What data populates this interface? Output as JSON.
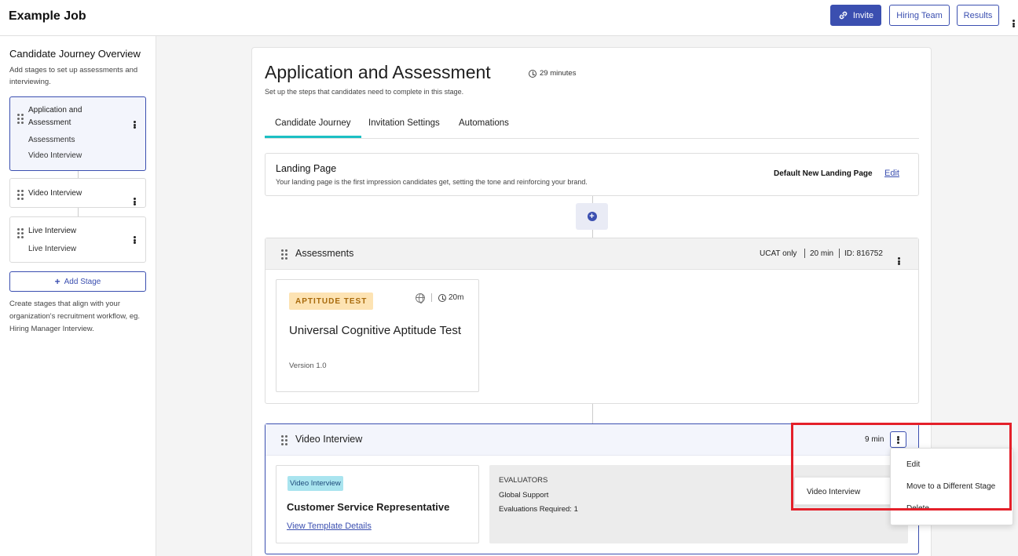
{
  "header": {
    "job_title": "Example Job",
    "invite_label": "Invite",
    "hiring_team_label": "Hiring Team",
    "results_label": "Results"
  },
  "sidebar": {
    "title": "Candidate Journey Overview",
    "description": "Add stages to set up assessments and interviewing.",
    "stages": [
      {
        "name": "Application and Assessment",
        "items": [
          "Assessments",
          "Video Interview"
        ]
      },
      {
        "name": "Video Interview",
        "items": []
      },
      {
        "name": "Live Interview",
        "items": [
          "Live Interview"
        ]
      }
    ],
    "add_stage_label": "Add Stage",
    "footer_text": "Create stages that align with your organization's recruitment workflow, eg. Hiring Manager Interview."
  },
  "main": {
    "title": "Application and Assessment",
    "duration": "29 minutes",
    "subtitle": "Set up the steps that candidates need to complete in this stage.",
    "tabs": [
      {
        "label": "Candidate Journey",
        "active": true
      },
      {
        "label": "Invitation Settings",
        "active": false
      },
      {
        "label": "Automations",
        "active": false
      }
    ],
    "landing_page": {
      "title": "Landing Page",
      "description": "Your landing page is the first impression candidates get, setting the tone and reinforcing your brand.",
      "selected": "Default New Landing Page",
      "edit_label": "Edit"
    },
    "assessments": {
      "title": "Assessments",
      "meta_type": "UCAT only",
      "meta_duration": "20 min",
      "meta_id": "ID: 816752",
      "test": {
        "badge": "APTITUDE TEST",
        "duration": "20m",
        "name": "Universal Cognitive Aptitude Test",
        "version": "Version 1.0"
      }
    },
    "video_interview": {
      "title": "Video Interview",
      "duration": "9 min",
      "badge": "Video Interview",
      "template_name": "Customer Service Representative",
      "template_link": "View Template Details",
      "evaluators_heading": "EVALUATORS",
      "evaluator_group": "Global Support",
      "evaluations_required": "Evaluations Required: 1"
    }
  },
  "context_menu": {
    "submenu_item": "Video Interview",
    "items": [
      "Edit",
      "Move to a Different Stage",
      "Delete"
    ]
  },
  "colors": {
    "primary": "#3b4fb0",
    "tab_underline": "#1cbfc3",
    "aptitude_badge_bg": "#fde3b3",
    "video_badge_bg": "#a9e4ef",
    "highlight_border": "#e4202a"
  }
}
